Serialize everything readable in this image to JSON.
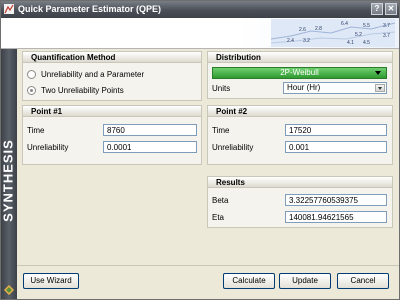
{
  "window": {
    "title": "Quick Parameter Estimator (QPE)",
    "help_label": "?",
    "close_label": "✕"
  },
  "header": {
    "numbers": [
      "6.4",
      "5.5",
      "3.7",
      "2.6",
      "2.8",
      "5.2",
      "2.4",
      "3.2",
      "4.1",
      "4.5",
      "3.7"
    ]
  },
  "sidebar": {
    "brand": "SYNTHESIS"
  },
  "quantification": {
    "title": "Quantification Method",
    "options": [
      {
        "label": "Unreliability and a Parameter",
        "checked": false
      },
      {
        "label": "Two Unreliability Points",
        "checked": true
      }
    ]
  },
  "distribution": {
    "title": "Distribution",
    "selected": "2P-Weibull",
    "units_label": "Units",
    "units_value": "Hour (Hr)",
    "accent": "#3fae3f"
  },
  "point1": {
    "title": "Point #1",
    "time_label": "Time",
    "time_value": "8760",
    "unrel_label": "Unreliability",
    "unrel_value": "0.0001"
  },
  "point2": {
    "title": "Point #2",
    "time_label": "Time",
    "time_value": "17520",
    "unrel_label": "Unreliability",
    "unrel_value": "0.001"
  },
  "results": {
    "title": "Results",
    "beta_label": "Beta",
    "beta_value": "3.32257760539375",
    "eta_label": "Eta",
    "eta_value": "140081.94621565"
  },
  "buttons": {
    "wizard": "Use Wizard",
    "calculate": "Calculate",
    "update": "Update",
    "cancel": "Cancel"
  }
}
